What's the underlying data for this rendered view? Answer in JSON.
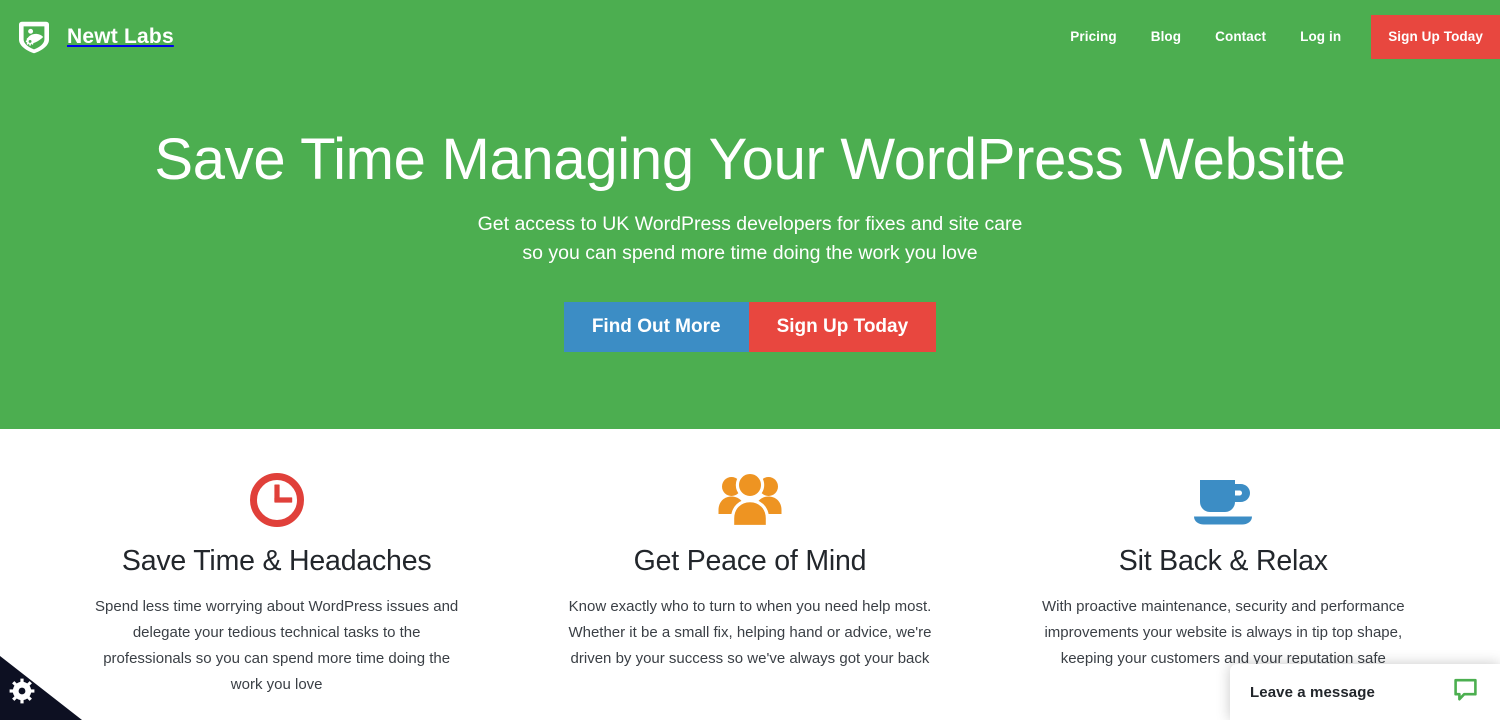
{
  "header": {
    "brand": {
      "name": "Newt Labs",
      "logo_icon": "newt-shield-logo",
      "logo_color": "#FFFFFF"
    },
    "nav": [
      {
        "label": "Pricing"
      },
      {
        "label": "Blog"
      },
      {
        "label": "Contact"
      },
      {
        "label": "Log in"
      }
    ],
    "cta": {
      "label": "Sign Up Today",
      "color": "#E8473F"
    },
    "background_color": "#4CAE50"
  },
  "hero": {
    "title": "Save Time Managing Your WordPress Website",
    "subtitle_line1": "Get access to UK WordPress developers for fixes and site care",
    "subtitle_line2": "so you can spend more time doing the work you love",
    "buttons": [
      {
        "label": "Find Out More",
        "color": "#3C8DC5"
      },
      {
        "label": "Sign Up Today",
        "color": "#E8473F"
      }
    ],
    "background_color": "#4CAE50"
  },
  "features": [
    {
      "icon": "clock-icon",
      "icon_color": "#E0403A",
      "title": "Save Time & Headaches",
      "body": "Spend less time worrying about WordPress issues and delegate your tedious technical tasks to the professionals so you can spend more time doing the work you love"
    },
    {
      "icon": "people-group-icon",
      "icon_color": "#EE9422",
      "title": "Get Peace of Mind",
      "body": "Know exactly who to turn to when you need help most. Whether it be a small fix, helping hand or advice, we're driven by your success so we've always got your back"
    },
    {
      "icon": "coffee-cup-icon",
      "icon_color": "#3C8DC5",
      "title": "Sit Back & Relax",
      "body": "With proactive maintenance, security and performance improvements your website is always in tip top shape, keeping your customers and your reputation safe"
    }
  ],
  "chat_widget": {
    "label": "Leave a message",
    "icon": "chat-bubble-icon",
    "icon_color": "#4CAF50"
  },
  "corner_tab": {
    "icon": "gear-icon",
    "icon_color": "#FFFFFF",
    "background_color": "#0D1022"
  }
}
